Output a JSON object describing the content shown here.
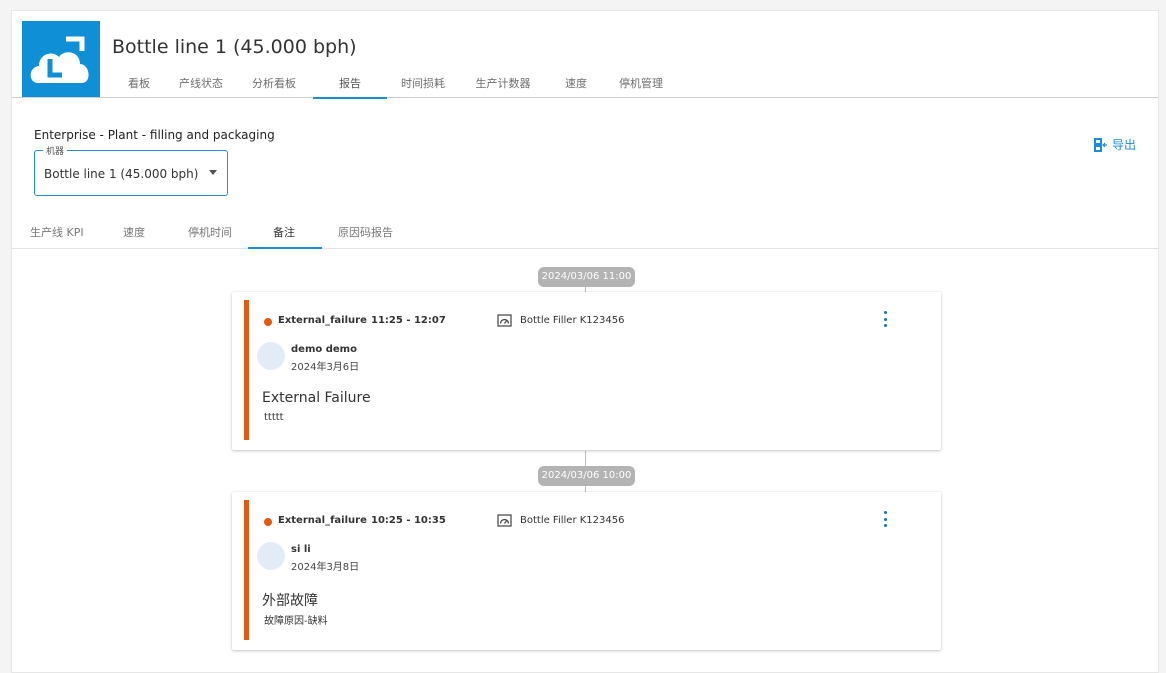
{
  "header": {
    "title": "Bottle line 1 (45.000 bph)",
    "tabs": [
      {
        "label": "看板"
      },
      {
        "label": "产线状态"
      },
      {
        "label": "分析看板"
      },
      {
        "label": "报告"
      },
      {
        "label": "时间损耗"
      },
      {
        "label": "生产计数器"
      },
      {
        "label": "速度"
      },
      {
        "label": "停机管理"
      }
    ],
    "active_tab": "报告"
  },
  "context": {
    "breadcrumb": "Enterprise - Plant - filling and packaging",
    "export_label": "导出"
  },
  "machine_select": {
    "legend": "机器",
    "value": "Bottle line 1 (45.000 bph)"
  },
  "subtabs": {
    "items": [
      {
        "label": "生产线 KPI"
      },
      {
        "label": "速度"
      },
      {
        "label": "停机时间"
      },
      {
        "label": "备注"
      },
      {
        "label": "原因码报告"
      }
    ],
    "active": "备注"
  },
  "timeline": [
    {
      "time_label": "2024/03/06 11:00",
      "note": {
        "reason": "External_failure",
        "time_range": "11:25 - 12:07",
        "machine": "Bottle Filler K123456",
        "user": "demo demo",
        "date": "2024年3月6日",
        "title": "External Failure",
        "body": "ttttt"
      }
    },
    {
      "time_label": "2024/03/06 10:00",
      "note": {
        "reason": "External_failure",
        "time_range": "10:25 - 10:35",
        "machine": "Bottle Filler K123456",
        "user": "si li",
        "date": "2024年3月8日",
        "title": "外部故障",
        "body": "故障原因-缺料"
      }
    }
  ],
  "colors": {
    "accent": "#1a8cd8",
    "logo_bg": "#0f8fd6",
    "status_bar": "#e05a14",
    "badge_bg": "#b3b3b3"
  },
  "icons": {
    "logo": "cloud-logo-icon",
    "export": "export-icon",
    "machine": "gauge-icon",
    "menu": "kebab-menu-icon"
  }
}
